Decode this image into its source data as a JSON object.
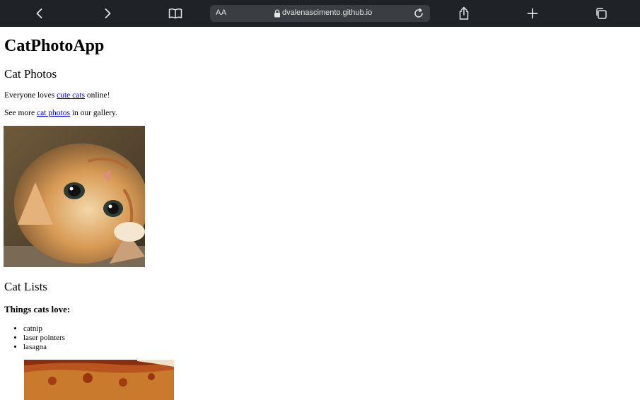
{
  "browser": {
    "aa_label": "AA",
    "url": "dvalenascimento.github.io",
    "icons": [
      "back-icon",
      "forward-icon",
      "bookmarks-icon",
      "lock-icon",
      "reload-icon",
      "share-icon",
      "add-tab-icon",
      "tabs-icon"
    ]
  },
  "page": {
    "title": "CatPhotoApp",
    "section1_heading": "Cat Photos",
    "p1_before": "Everyone loves ",
    "p1_link": "cute cats",
    "p1_after": " online!",
    "p2_before": "See more ",
    "p2_link": "cat photos",
    "p2_after": " in our gallery.",
    "section2_heading": "Cat Lists",
    "list_heading": "Things cats love:",
    "list_items": [
      "catnip",
      "laser pointers",
      "lasagna"
    ]
  },
  "colors": {
    "toolbar_bg": "#1f2226",
    "address_bg": "#3a3d42",
    "link": "#0000ee"
  }
}
